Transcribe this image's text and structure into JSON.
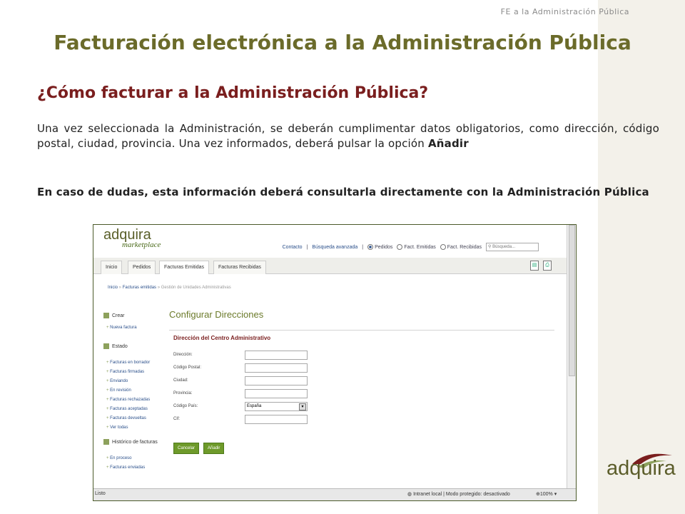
{
  "header": {
    "small": "FE a la Administración Pública"
  },
  "title": "Facturación electrónica a la Administración Pública",
  "subtitle": "¿Cómo facturar a la Administración Pública?",
  "paragraphs": {
    "p1_text": "Una vez seleccionada la Administración, se deberán cumplimentar  datos obligatorios, como dirección, código postal, ciudad, provincia. Una vez informados, deberá pulsar la opción ",
    "p1_bold": "Añadir",
    "p2": "En caso de dudas, esta información deberá consultarla  directamente con la Administración Pública"
  },
  "screenshot": {
    "logo_main": "adquira",
    "logo_sub": "marketplace",
    "top_links": {
      "contacto": "Contacto",
      "busqueda": "Búsqueda avanzada",
      "pedidos": "Pedidos",
      "fact_emitidas": "Fact. Emitidas",
      "fact_recibidas": "Fact. Recibidas",
      "search_placeholder": "Búsqueda..."
    },
    "tabs": [
      "Inicio",
      "Pedidos",
      "Facturas Emitidas",
      "Facturas Recibidas"
    ],
    "breadcrumb": {
      "inicio": "Inicio",
      "emitidas": "Facturas emitidas",
      "current": "Gestión de Unidades Administrativas"
    },
    "sidebar": {
      "crear": "Crear",
      "nueva": "Nueva factura",
      "estado": "Estado",
      "estado_items": [
        "Facturas en borrador",
        "Facturas firmadas",
        "Enviando",
        "En revisión",
        "Facturas rechazadas",
        "Facturas aceptadas",
        "Facturas devueltas",
        "Ver todas"
      ],
      "historico": "Histórico de facturas",
      "historico_items": [
        "En proceso",
        "Facturas enviadas"
      ]
    },
    "content": {
      "title": "Configurar Direcciones",
      "section": "Dirección del Centro Administrativo",
      "fields": {
        "direccion": "Dirección:",
        "cp": "Código Postal:",
        "ciudad": "Ciudad:",
        "provincia": "Provincia:",
        "pais": "Código País:",
        "pais_value": "España",
        "cif": "Cif:"
      },
      "cancel": "Cancelar",
      "add": "Añadir"
    },
    "status": {
      "listo": "Listo",
      "mode": "Intranet local | Modo protegido: desactivado",
      "zoom": "100%"
    }
  },
  "brand": "adquira",
  "colors": {
    "title": "#6b6b2a",
    "subtitle": "#7a1e1e",
    "green_button": "#6e9a2a"
  }
}
